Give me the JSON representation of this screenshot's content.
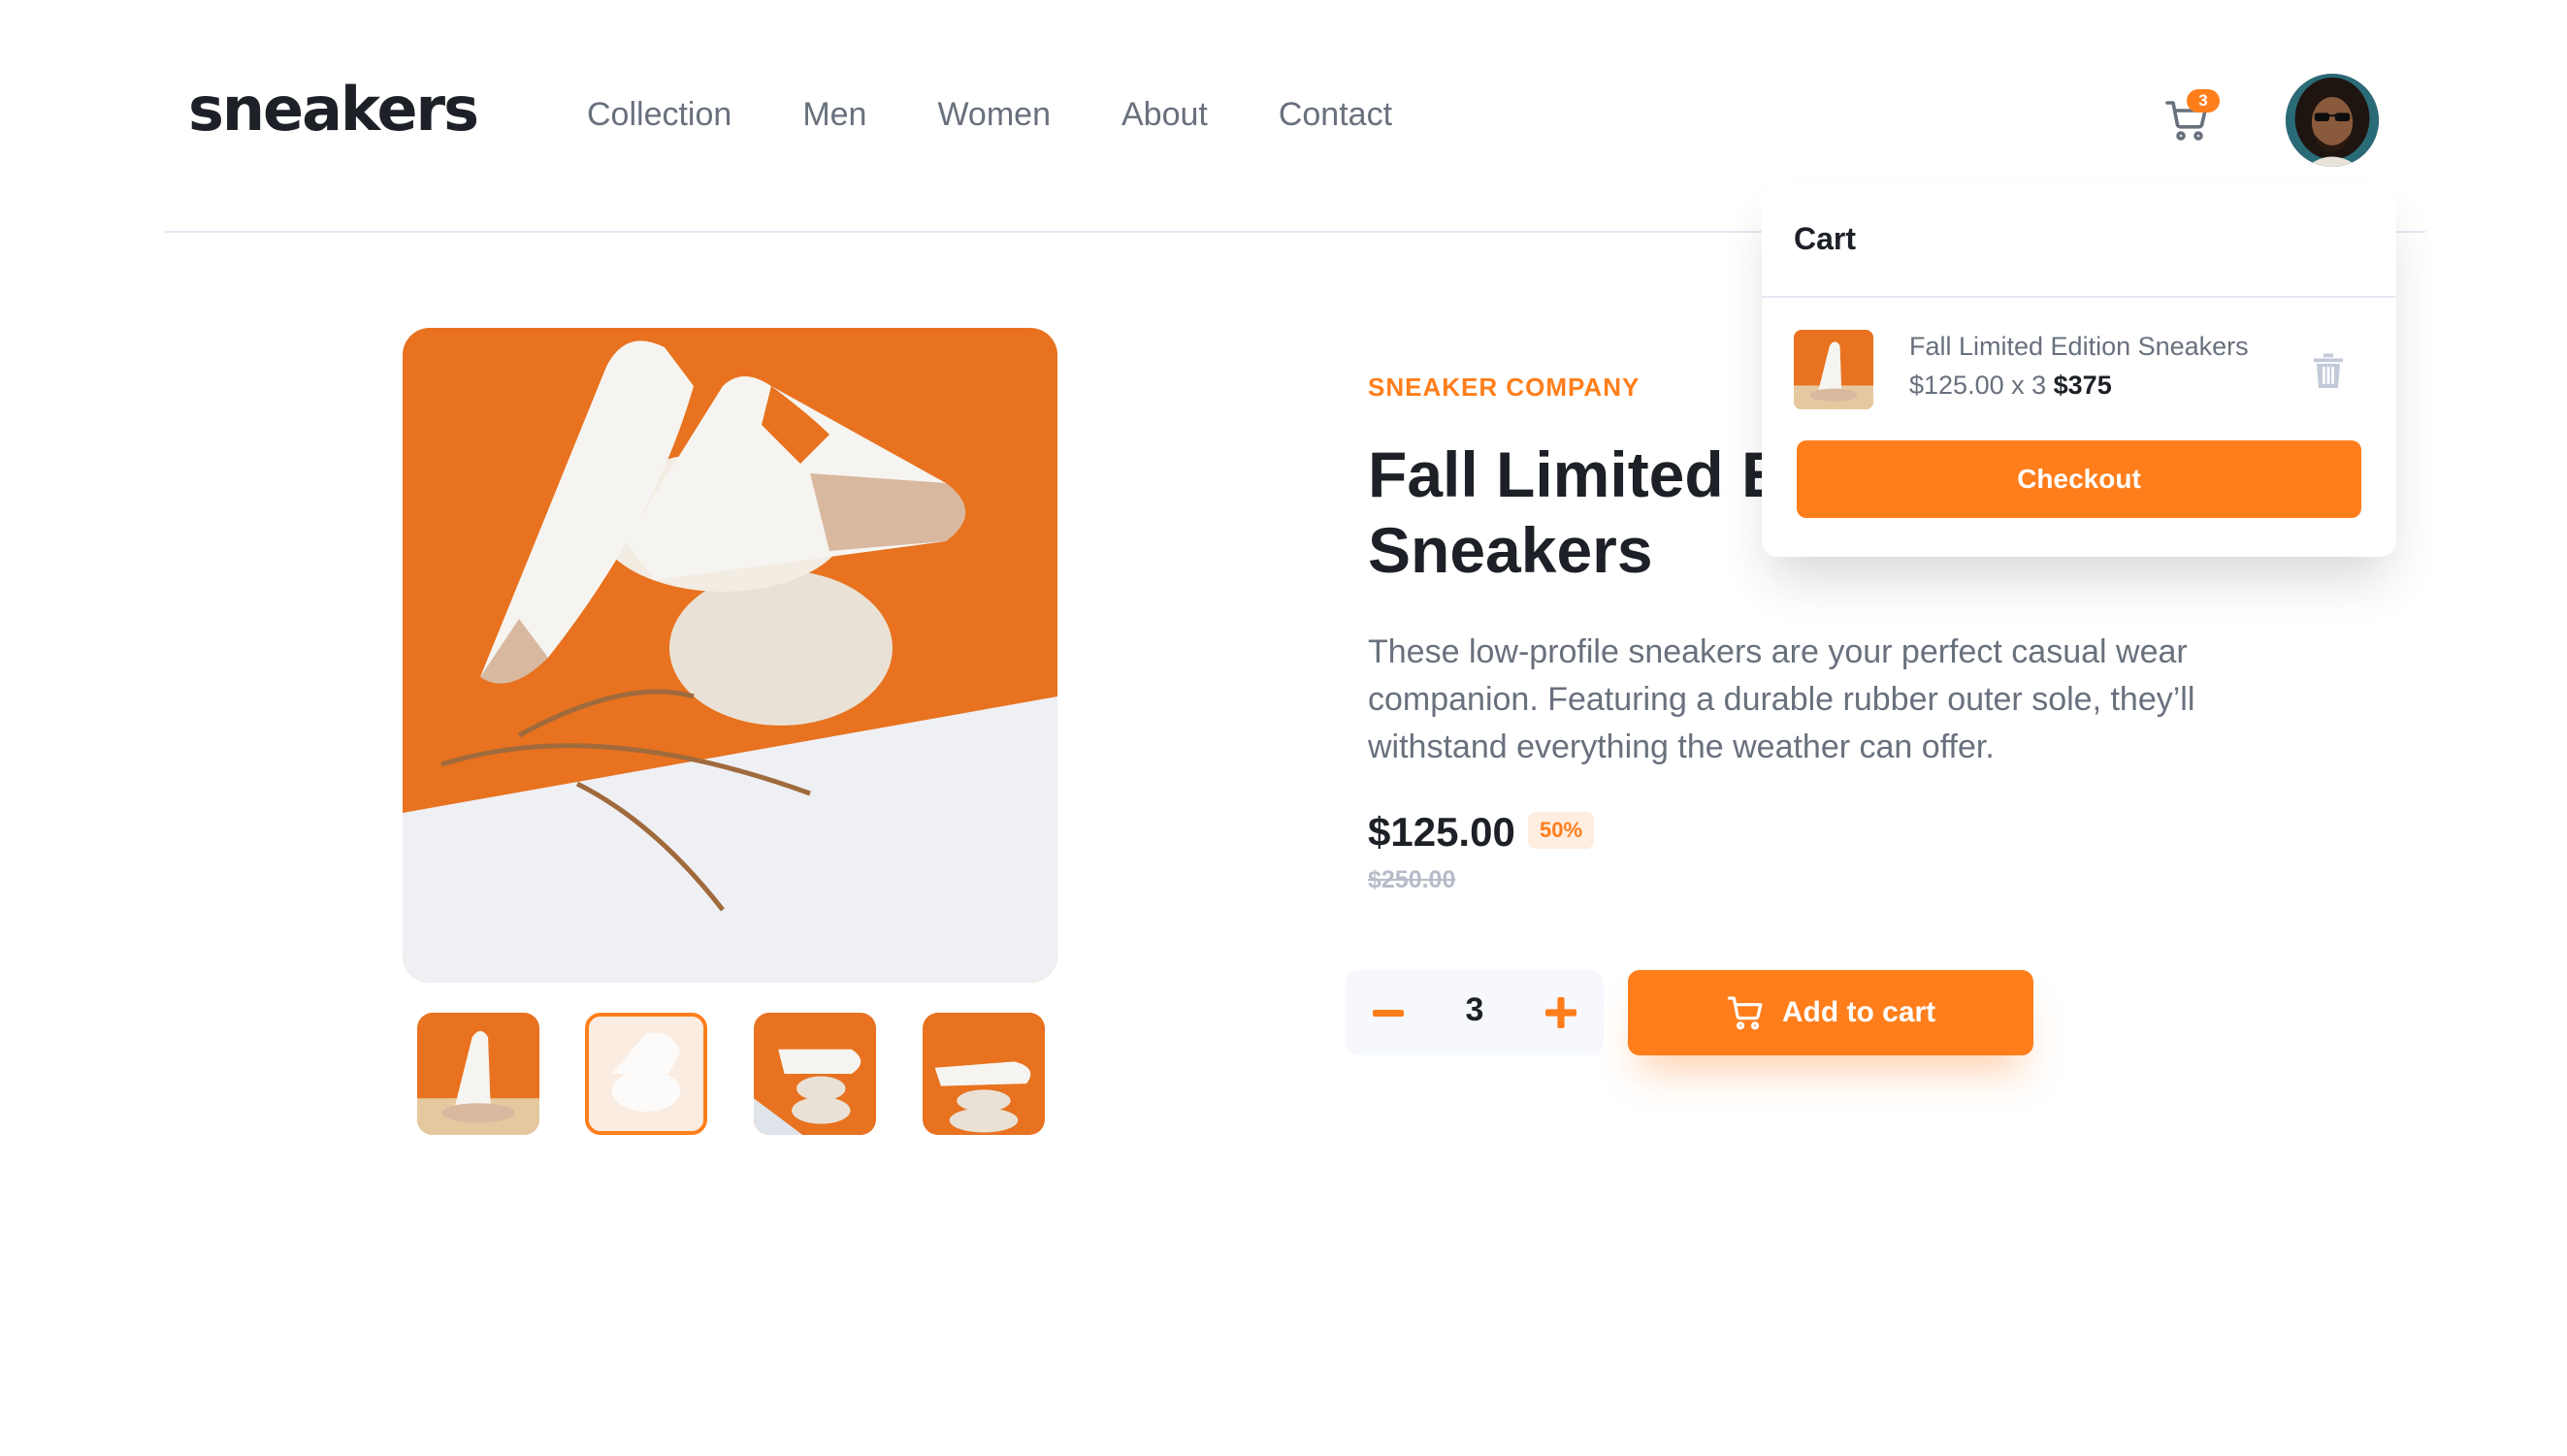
{
  "brand": {
    "logo": "sneakers"
  },
  "nav": {
    "items": [
      {
        "label": "Collection"
      },
      {
        "label": "Men"
      },
      {
        "label": "Women"
      },
      {
        "label": "About"
      },
      {
        "label": "Contact"
      }
    ]
  },
  "header": {
    "cart_icon": "cart-icon",
    "cart_count": "3",
    "avatar": "user-avatar"
  },
  "gallery": {
    "active_thumbnail_index": 1,
    "thumbnail_count": 4
  },
  "product": {
    "company": "SNEAKER COMPANY",
    "title_line1": "Fall Limited Edition",
    "title_line2": "Sneakers",
    "description": "These low-profile sneakers are your perfect casual wear companion. Featuring a durable rubber outer sole, they’ll withstand everything the weather can offer.",
    "price": "$125.00",
    "discount": "50%",
    "old_price": "$250.00"
  },
  "quantity": {
    "value": "3",
    "minus_icon": "minus-icon",
    "plus_icon": "plus-icon"
  },
  "add_to_cart": {
    "label": "Add to cart",
    "icon": "cart-icon"
  },
  "cart_panel": {
    "title": "Cart",
    "item": {
      "name": "Fall Limited Edition Sneakers",
      "unit_price_qty": "$125.00 x 3",
      "total": "$375",
      "delete_icon": "trash-icon"
    },
    "checkout_label": "Checkout"
  },
  "colors": {
    "accent": "#ff7e1b",
    "accent_light": "#ffede0",
    "text_dark": "#1d2026",
    "text_grey": "#69707d",
    "text_light": "#b6bcc8"
  }
}
